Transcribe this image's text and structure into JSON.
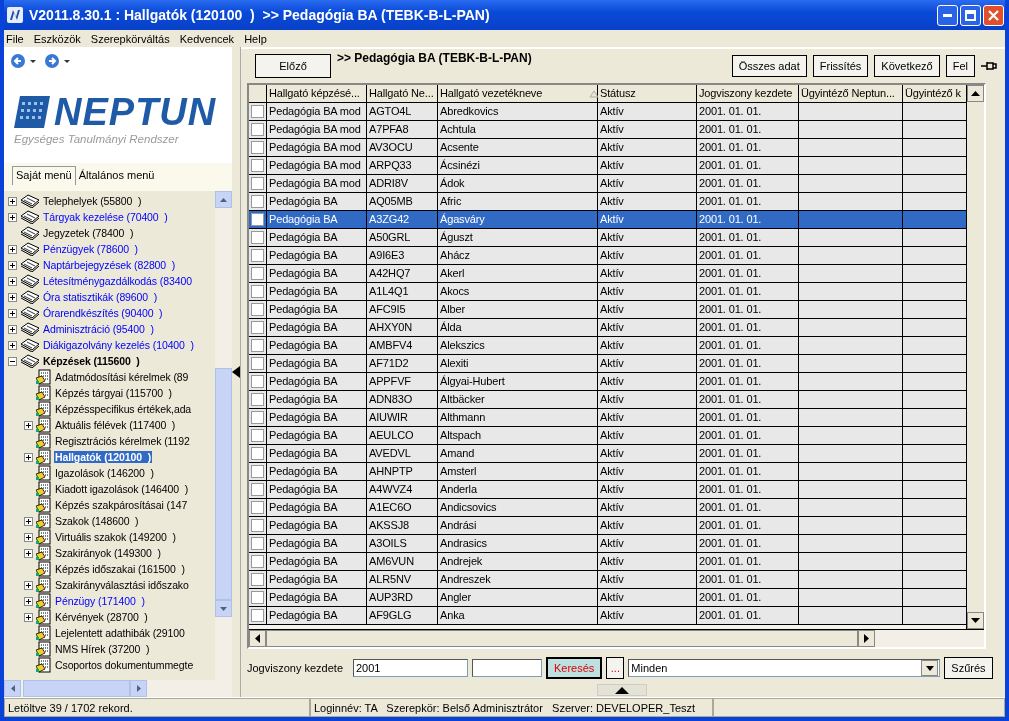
{
  "window": {
    "title": "V2011.8.30.1 : Hallgatók (120100  )  >> Pedagógia BA (TEBK-B-L-PAN)"
  },
  "menu": [
    "File",
    "Eszközök",
    "Szerepkörváltás",
    "Kedvencek",
    "Help"
  ],
  "logo": {
    "name": "NEPTUN",
    "tagline": "Egységes Tanulmányi Rendszer"
  },
  "menu_tabs": [
    {
      "label": "Saját menü",
      "selected": true
    },
    {
      "label": "Általános menü",
      "selected": false
    }
  ],
  "tree": [
    {
      "label": "Telephelyek (55800  )",
      "kind": "plain",
      "expandable": true,
      "expanded": false,
      "selected": false
    },
    {
      "label": "Tárgyak kezelése (70400  )",
      "kind": "link",
      "expandable": true,
      "expanded": false,
      "selected": false
    },
    {
      "label": "Jegyzetek (78400  )",
      "kind": "plain",
      "expandable": false,
      "expanded": false,
      "selected": false
    },
    {
      "label": "Pénzügyek (78600  )",
      "kind": "link",
      "expandable": true,
      "expanded": false,
      "selected": false
    },
    {
      "label": "Naptárbejegyzések (82800  )",
      "kind": "link",
      "expandable": true,
      "expanded": false,
      "selected": false
    },
    {
      "label": "Létesítménygazdálkodás (83400",
      "kind": "link",
      "expandable": true,
      "expanded": false,
      "selected": false
    },
    {
      "label": "Óra statisztikák (89600  )",
      "kind": "link",
      "expandable": true,
      "expanded": false,
      "selected": false
    },
    {
      "label": "Órarendkészítés (90400  )",
      "kind": "link",
      "expandable": true,
      "expanded": false,
      "selected": false
    },
    {
      "label": "Adminisztráció (95400  )",
      "kind": "link",
      "expandable": true,
      "expanded": false,
      "selected": false
    },
    {
      "label": "Diákigazolvány kezelés (10400  )",
      "kind": "link",
      "expandable": true,
      "expanded": false,
      "selected": false
    },
    {
      "label": "Képzések (115600  )",
      "kind": "plain",
      "expandable": true,
      "expanded": true,
      "selected": false,
      "children": [
        {
          "label": "Adatmódosítási kérelmek (89",
          "kind": "plain",
          "expandable": false,
          "selected": false
        },
        {
          "label": "Képzés tárgyai (115700  )",
          "kind": "plain",
          "expandable": false,
          "selected": false
        },
        {
          "label": "Képzésspecifikus értékek,ada",
          "kind": "plain",
          "expandable": false,
          "selected": false
        },
        {
          "label": "Aktuális félévek (117400  )",
          "kind": "plain",
          "expandable": true,
          "selected": false
        },
        {
          "label": "Regisztrációs kérelmek (1192",
          "kind": "plain",
          "expandable": false,
          "selected": false
        },
        {
          "label": "Hallgatók (120100  )",
          "kind": "plain",
          "expandable": true,
          "selected": true
        },
        {
          "label": "Igazolások (146200  )",
          "kind": "plain",
          "expandable": false,
          "selected": false
        },
        {
          "label": "Kiadott igazolások (146400  )",
          "kind": "plain",
          "expandable": false,
          "selected": false
        },
        {
          "label": "Képzés szakpárosításai (147",
          "kind": "plain",
          "expandable": false,
          "selected": false
        },
        {
          "label": "Szakok (148600  )",
          "kind": "plain",
          "expandable": true,
          "selected": false
        },
        {
          "label": "Virtuális szakok (149200  )",
          "kind": "plain",
          "expandable": true,
          "selected": false
        },
        {
          "label": "Szakirányok (149300  )",
          "kind": "plain",
          "expandable": true,
          "selected": false
        },
        {
          "label": "Képzés időszakai (161500  )",
          "kind": "plain",
          "expandable": false,
          "selected": false
        },
        {
          "label": "Szakirányválasztási időszako",
          "kind": "plain",
          "expandable": true,
          "selected": false
        },
        {
          "label": "Pénzügy (171400  )",
          "kind": "link",
          "expandable": true,
          "selected": false
        },
        {
          "label": "Kérvények (28700  )",
          "kind": "plain",
          "expandable": true,
          "selected": false
        },
        {
          "label": "Lejelentett adathibák (29100",
          "kind": "plain",
          "expandable": false,
          "selected": false
        },
        {
          "label": "NMS Hírek (37200  )",
          "kind": "plain",
          "expandable": false,
          "selected": false
        },
        {
          "label": "Csoportos dokumentummegte",
          "kind": "plain",
          "expandable": false,
          "selected": false
        }
      ]
    }
  ],
  "toolbar": {
    "back_button": "Előző",
    "path": ">> Pedagógia BA (TEBK-B-L-PAN)",
    "buttons": [
      "Összes adat",
      "Frissítés",
      "Következő",
      "Fel"
    ]
  },
  "table": {
    "columns": [
      "Hallgató képzésé...",
      "Hallgató Ne...",
      "Hallgató vezetékneve",
      "Státusz",
      "Jogviszony kezdete",
      "Ügyintéző Neptun...",
      "Ügyintéző k"
    ],
    "rows": [
      {
        "checked": false,
        "selected": false,
        "cells": [
          "Pedagógia BA mod",
          "AGTO4L",
          "Abredkovics",
          "Aktív",
          "2001. 01. 01."
        ]
      },
      {
        "checked": false,
        "selected": false,
        "cells": [
          "Pedagógia BA mod",
          "A7PFA8",
          "Achtula",
          "Aktív",
          "2001. 01. 01."
        ]
      },
      {
        "checked": false,
        "selected": false,
        "cells": [
          "Pedagógia BA mod",
          "AV3OCU",
          "Acsente",
          "Aktív",
          "2001. 01. 01."
        ]
      },
      {
        "checked": false,
        "selected": false,
        "cells": [
          "Pedagógia BA mod",
          "ARPQ33",
          "Ácsinézi",
          "Aktív",
          "2001. 01. 01."
        ]
      },
      {
        "checked": false,
        "selected": false,
        "cells": [
          "Pedagógia BA mod",
          "ADRI8V",
          "Ádok",
          "Aktív",
          "2001. 01. 01."
        ]
      },
      {
        "checked": false,
        "selected": false,
        "cells": [
          "Pedagógia BA",
          "AQ05MB",
          "Afric",
          "Aktív",
          "2001. 01. 01."
        ]
      },
      {
        "checked": false,
        "selected": true,
        "cells": [
          "Pedagógia BA",
          "A3ZG42",
          "Ágasváry",
          "Aktív",
          "2001. 01. 01."
        ]
      },
      {
        "checked": false,
        "selected": false,
        "cells": [
          "Pedagógia BA",
          "A50GRL",
          "Águszt",
          "Aktív",
          "2001. 01. 01."
        ]
      },
      {
        "checked": false,
        "selected": false,
        "cells": [
          "Pedagógia BA",
          "A9I6E3",
          "Ahácz",
          "Aktív",
          "2001. 01. 01."
        ]
      },
      {
        "checked": false,
        "selected": false,
        "cells": [
          "Pedagógia BA",
          "A42HQ7",
          "Akerl",
          "Aktív",
          "2001. 01. 01."
        ]
      },
      {
        "checked": false,
        "selected": false,
        "cells": [
          "Pedagógia BA",
          "A1L4Q1",
          "Akocs",
          "Aktív",
          "2001. 01. 01."
        ]
      },
      {
        "checked": false,
        "selected": false,
        "cells": [
          "Pedagógia BA",
          "AFC9I5",
          "Alber",
          "Aktív",
          "2001. 01. 01."
        ]
      },
      {
        "checked": false,
        "selected": false,
        "cells": [
          "Pedagógia BA",
          "AHXY0N",
          "Álda",
          "Aktív",
          "2001. 01. 01."
        ]
      },
      {
        "checked": false,
        "selected": false,
        "cells": [
          "Pedagógia BA",
          "AMBFV4",
          "Alekszics",
          "Aktív",
          "2001. 01. 01."
        ]
      },
      {
        "checked": false,
        "selected": false,
        "cells": [
          "Pedagógia BA",
          "AF71D2",
          "Alexiti",
          "Aktív",
          "2001. 01. 01."
        ]
      },
      {
        "checked": false,
        "selected": false,
        "cells": [
          "Pedagógia BA",
          "APPFVF",
          "Álgyai-Hubert",
          "Aktív",
          "2001. 01. 01."
        ]
      },
      {
        "checked": false,
        "selected": false,
        "cells": [
          "Pedagógia BA",
          "ADN83O",
          "Altbäcker",
          "Aktív",
          "2001. 01. 01."
        ]
      },
      {
        "checked": false,
        "selected": false,
        "cells": [
          "Pedagógia BA",
          "AIUWIR",
          "Althmann",
          "Aktív",
          "2001. 01. 01."
        ]
      },
      {
        "checked": false,
        "selected": false,
        "cells": [
          "Pedagógia BA",
          "AEULCO",
          "Altspach",
          "Aktív",
          "2001. 01. 01."
        ]
      },
      {
        "checked": false,
        "selected": false,
        "cells": [
          "Pedagógia BA",
          "AVEDVL",
          "Amand",
          "Aktív",
          "2001. 01. 01."
        ]
      },
      {
        "checked": false,
        "selected": false,
        "cells": [
          "Pedagógia BA",
          "AHNPTP",
          "Amsterl",
          "Aktív",
          "2001. 01. 01."
        ]
      },
      {
        "checked": false,
        "selected": false,
        "cells": [
          "Pedagógia BA",
          "A4WVZ4",
          "Anderla",
          "Aktív",
          "2001. 01. 01."
        ]
      },
      {
        "checked": false,
        "selected": false,
        "cells": [
          "Pedagógia BA",
          "A1EC6O",
          "Andicsovics",
          "Aktív",
          "2001. 01. 01."
        ]
      },
      {
        "checked": false,
        "selected": false,
        "cells": [
          "Pedagógia BA",
          "AKSSJ8",
          "Andrási",
          "Aktív",
          "2001. 01. 01."
        ]
      },
      {
        "checked": false,
        "selected": false,
        "cells": [
          "Pedagógia BA",
          "A3OILS",
          "Andrasics",
          "Aktív",
          "2001. 01. 01."
        ]
      },
      {
        "checked": false,
        "selected": false,
        "cells": [
          "Pedagógia BA",
          "AM6VUN",
          "Andrejek",
          "Aktív",
          "2001. 01. 01."
        ]
      },
      {
        "checked": false,
        "selected": false,
        "cells": [
          "Pedagógia BA",
          "ALR5NV",
          "Andreszek",
          "Aktív",
          "2001. 01. 01."
        ]
      },
      {
        "checked": false,
        "selected": false,
        "cells": [
          "Pedagógia BA",
          "AUP3RD",
          "Angler",
          "Aktív",
          "2001. 01. 01."
        ]
      },
      {
        "checked": false,
        "selected": false,
        "cells": [
          "Pedagógia BA",
          "AF9GLG",
          "Anka",
          "Aktív",
          "2001. 01. 01."
        ]
      }
    ]
  },
  "filter": {
    "label": "Jogviszony kezdete",
    "value": "2001",
    "search_button": "Keresés",
    "more_button": "...",
    "dropdown": "Minden",
    "filter_button": "Szűrés"
  },
  "status_bar": {
    "records": "Letöltve 39 / 1702 rekord.",
    "session": "Loginnév: TA   Szerepkör: Belső Adminisztrátor   Szerver: DEVELOPER_Teszt"
  }
}
